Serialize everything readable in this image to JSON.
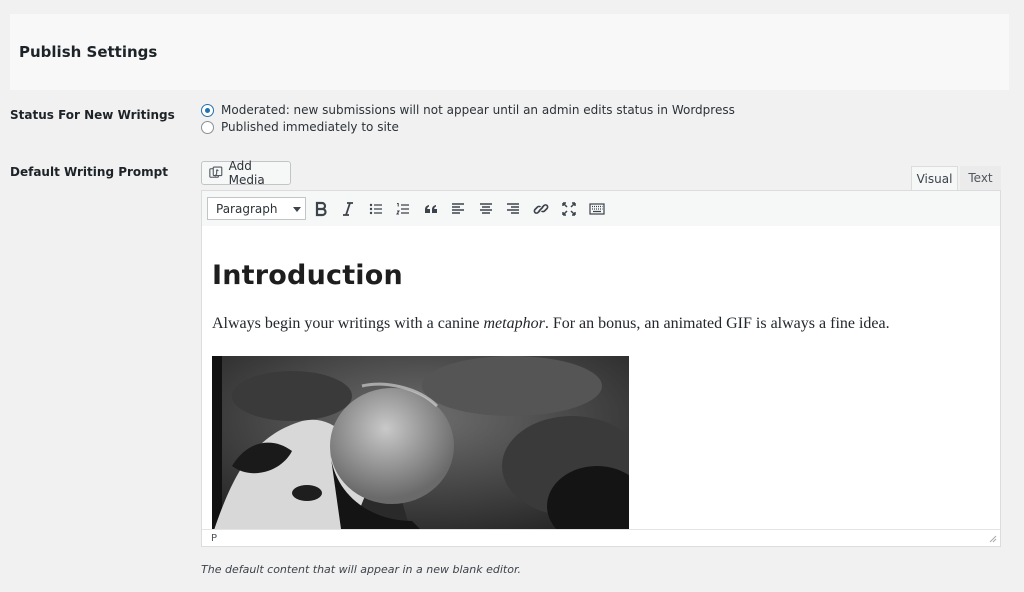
{
  "section": {
    "title": "Publish Settings"
  },
  "status_setting": {
    "label": "Status For New Writings",
    "options": [
      {
        "label": "Moderated: new submissions will not appear until an admin edits status in Wordpress",
        "selected": true
      },
      {
        "label": "Published immediately to site",
        "selected": false
      }
    ]
  },
  "prompt_setting": {
    "label": "Default Writing Prompt",
    "add_media_label": "Add Media",
    "tabs": [
      {
        "label": "Visual",
        "active": true
      },
      {
        "label": "Text",
        "active": false
      }
    ],
    "format_select": "Paragraph",
    "toolbar_icons": [
      "bold-icon",
      "italic-icon",
      "bullet-list-icon",
      "numbered-list-icon",
      "blockquote-icon",
      "align-left-icon",
      "align-center-icon",
      "align-right-icon",
      "link-icon",
      "fullscreen-icon",
      "toolbar-toggle-icon"
    ],
    "content": {
      "heading": "Introduction",
      "paragraph_before": "Always begin your writings with a canine ",
      "paragraph_em": "metaphor",
      "paragraph_after": ". For an bonus, an animated GIF is always a fine idea."
    },
    "status_path": "P",
    "description": "The default content that will appear in a new blank editor."
  },
  "colors": {
    "accent": "#2271b1",
    "background": "#f1f1f1"
  }
}
